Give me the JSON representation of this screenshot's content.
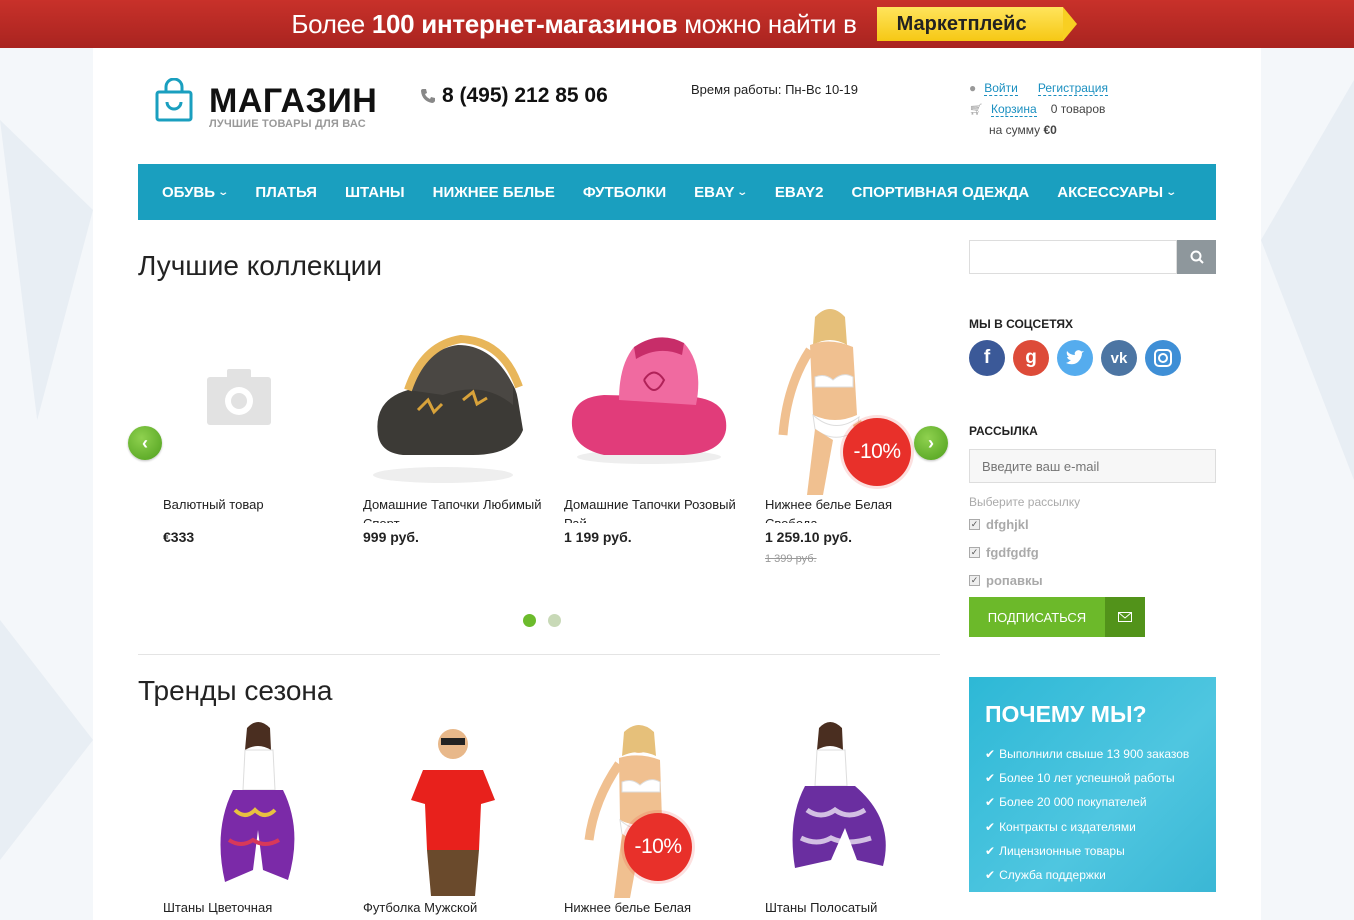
{
  "promo": {
    "text_before": "Более ",
    "text_bold": "100 интернет-магазинов",
    "text_after": " можно найти в",
    "button": "Маркетплейс"
  },
  "header": {
    "logo_title": "МАГАЗИН",
    "logo_subtitle": "ЛУЧШИЕ ТОВАРЫ ДЛЯ ВАС",
    "phone": "8 (495) 212 85 06",
    "hours": "Время работы: Пн-Вс 10-19",
    "login": "Войти",
    "register": "Регистрация",
    "cart": "Корзина",
    "cart_count": "0 товаров",
    "cart_sum_label": "на сумму",
    "cart_sum": "€0"
  },
  "nav": [
    {
      "label": "ОБУВЬ",
      "dropdown": true
    },
    {
      "label": "ПЛАТЬЯ",
      "dropdown": false
    },
    {
      "label": "ШТАНЫ",
      "dropdown": false
    },
    {
      "label": "НИЖНЕЕ БЕЛЬЕ",
      "dropdown": false
    },
    {
      "label": "ФУТБОЛКИ",
      "dropdown": false
    },
    {
      "label": "EBAY",
      "dropdown": true
    },
    {
      "label": "EBAY2",
      "dropdown": false
    },
    {
      "label": "СПОРТИВНАЯ ОДЕЖДА",
      "dropdown": false
    },
    {
      "label": "АКСЕССУАРЫ",
      "dropdown": true
    }
  ],
  "collections": {
    "title": "Лучшие коллекции",
    "products": [
      {
        "name": "Валютный товар",
        "price": "€333",
        "old_price": "",
        "sale": ""
      },
      {
        "name": "Домашние Тапочки Любимый Спорт",
        "price": "999 руб.",
        "old_price": "",
        "sale": ""
      },
      {
        "name": "Домашние Тапочки Розовый Рай",
        "price": "1 199 руб.",
        "old_price": "",
        "sale": ""
      },
      {
        "name": "Нижнее белье Белая Свобода",
        "price": "1 259.10 руб.",
        "old_price": "1 399 руб.",
        "sale": "-10%"
      }
    ]
  },
  "trends": {
    "title": "Тренды сезона",
    "products": [
      {
        "name": "Штаны Цветочная"
      },
      {
        "name": "Футболка Мужской"
      },
      {
        "name": "Нижнее белье Белая",
        "sale": "-10%"
      },
      {
        "name": "Штаны Полосатый"
      }
    ]
  },
  "sidebar": {
    "social_title": "МЫ В СОЦСЕТЯХ",
    "socials": [
      {
        "icon": "facebook-icon",
        "glyph": "f",
        "color": "#3b5998"
      },
      {
        "icon": "google-plus-icon",
        "glyph": "g",
        "color": "#dd4b39"
      },
      {
        "icon": "twitter-icon",
        "glyph": "t",
        "color": "#55acee"
      },
      {
        "icon": "vk-icon",
        "glyph": "vk",
        "color": "#4c75a3"
      },
      {
        "icon": "instagram-icon",
        "glyph": "◎",
        "color": "#3f8fd6"
      }
    ],
    "newsletter_title": "РАССЫЛКА",
    "email_placeholder": "Введите ваш e-mail",
    "choose_label": "Выберите рассылку",
    "options": [
      "dfghjkl",
      "fgdfgdfg",
      "ропавкы"
    ],
    "subscribe_button": "ПОДПИСАТЬСЯ"
  },
  "why": {
    "title": "ПОЧЕМУ МЫ?",
    "items": [
      "Выполнили свыше 13 900 заказов",
      "Более 10 лет успешной работы",
      "Более 20 000 покупателей",
      "Контракты с издателями",
      "Лицензионные товары",
      "Служба поддержки"
    ]
  },
  "colors": {
    "accent": "#1a9fbf",
    "promo": "#b8281f",
    "sale": "#e8302a",
    "button": "#6cb92a"
  }
}
